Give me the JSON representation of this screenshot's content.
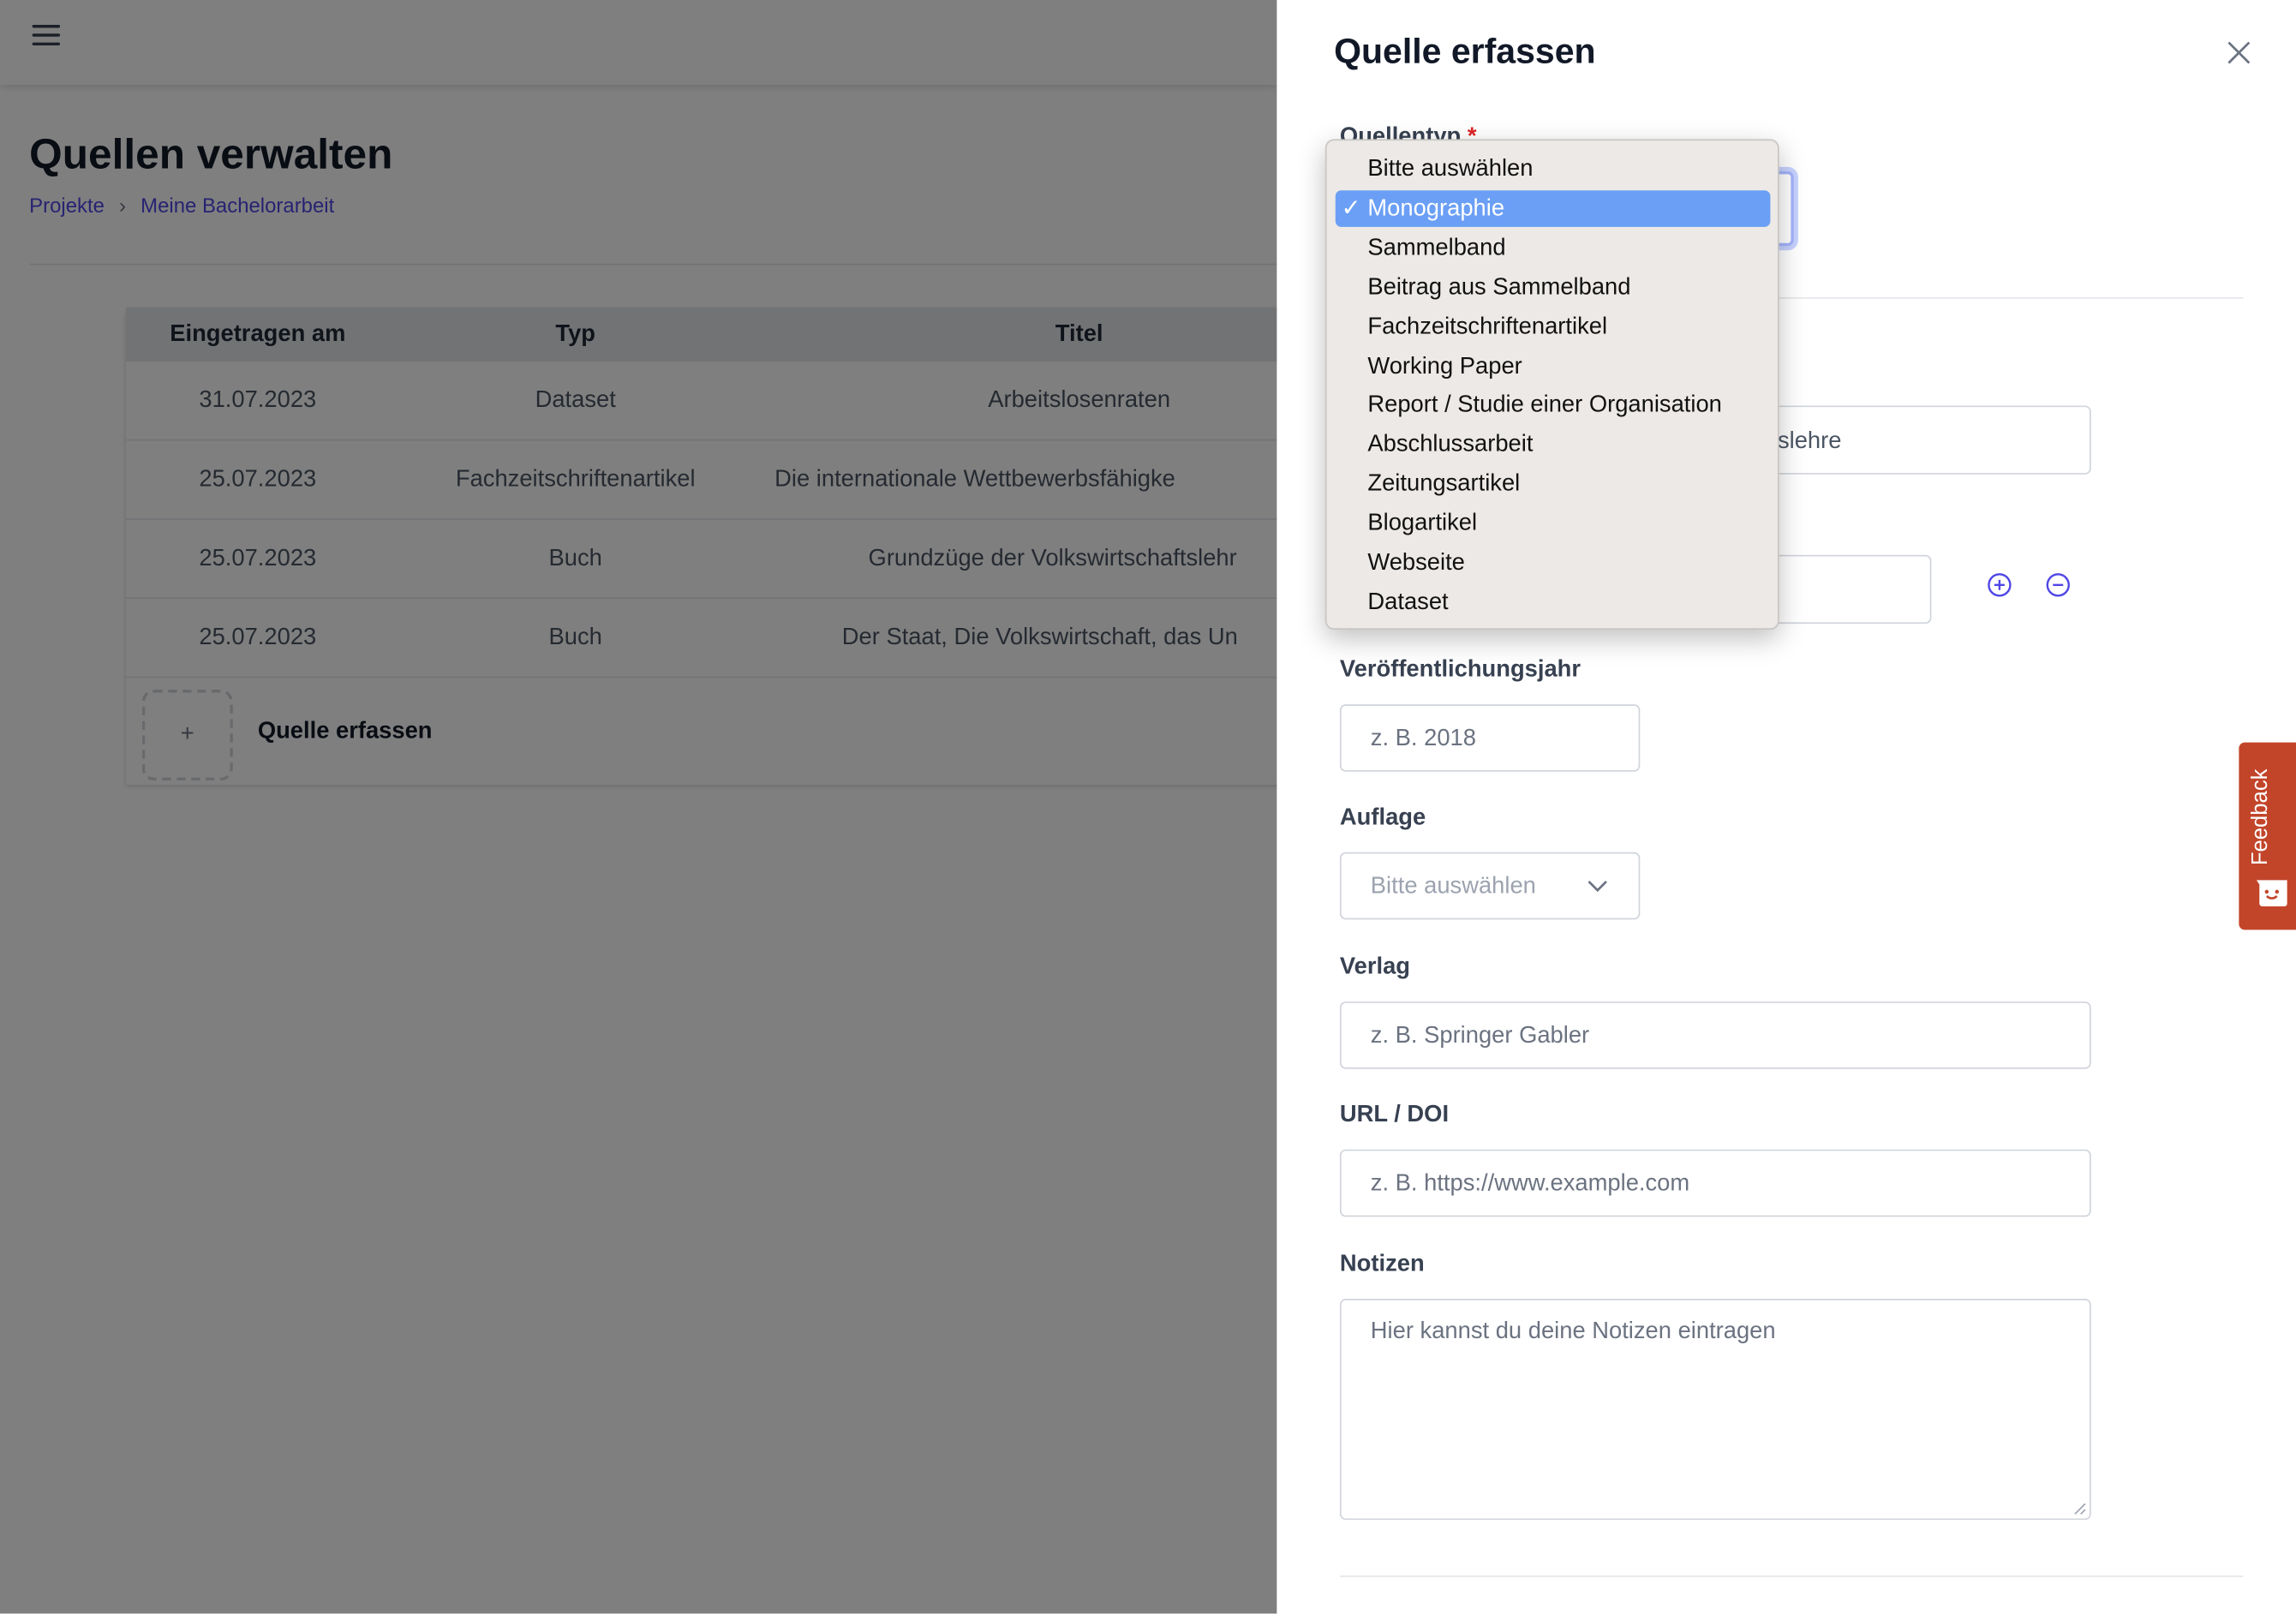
{
  "page": {
    "title": "Quellen verwalten",
    "breadcrumb": [
      "Projekte",
      "Meine Bachelorarbeit"
    ],
    "table": {
      "columns": [
        "Eingetragen am",
        "Typ",
        "Titel"
      ],
      "rows": [
        [
          "31.07.2023",
          "Dataset",
          "Arbeitslosenraten"
        ],
        [
          "25.07.2023",
          "Fachzeitschriftenartikel",
          "Die internationale Wettbewerbsfähigke"
        ],
        [
          "25.07.2023",
          "Buch",
          "Grundzüge der Volkswirtschaftslehr"
        ],
        [
          "25.07.2023",
          "Buch",
          "Der Staat, Die Volkswirtschaft, das Un"
        ]
      ],
      "add_label": "Quelle erfassen",
      "add_icon": "+"
    }
  },
  "panel": {
    "title": "Quelle erfassen",
    "source_type_label": "Quellentyp",
    "required_mark": "*",
    "title_field_value_fragment": "slehre",
    "year_label": "Veröffentlichungsjahr",
    "year_placeholder": "z. B. 2018",
    "edition_label": "Auflage",
    "edition_value": "Bitte auswählen",
    "publisher_label": "Verlag",
    "publisher_placeholder": "z. B. Springer Gabler",
    "url_label": "URL / DOI",
    "url_placeholder": "z. B. https://www.example.com",
    "notes_label": "Notizen",
    "notes_placeholder": "Hier kannst du deine Notizen eintragen"
  },
  "dropdown": {
    "selected": "Monographie",
    "check": "✓",
    "options": [
      "Bitte auswählen",
      "Monographie",
      "Sammelband",
      "Beitrag aus Sammelband",
      "Fachzeitschriftenartikel",
      "Working Paper",
      "Report / Studie einer Organisation",
      "Abschlussarbeit",
      "Zeitungsartikel",
      "Blogartikel",
      "Webseite",
      "Dataset"
    ]
  },
  "feedback": {
    "label": "Feedback",
    "color": "#c2452a"
  },
  "colors": {
    "accent": "#4f46e5",
    "highlight": "#6a9ff5"
  }
}
